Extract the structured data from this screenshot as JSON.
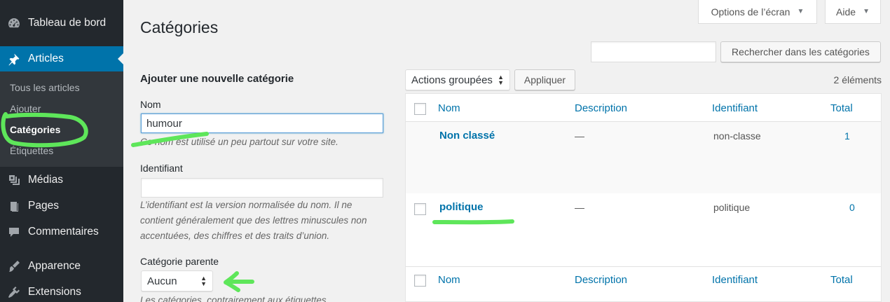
{
  "sidebar": {
    "dashboard": "Tableau de bord",
    "posts": "Articles",
    "sub": [
      "Tous les articles",
      "Ajouter",
      "Catégories",
      "Étiquettes"
    ],
    "media": "Médias",
    "pages": "Pages",
    "comments": "Commentaires",
    "appearance": "Apparence",
    "plugins": "Extensions"
  },
  "top": {
    "screen_options": "Options de l’écran",
    "help": "Aide"
  },
  "title": "Catégories",
  "search": {
    "value": "",
    "button": "Rechercher dans les catégories"
  },
  "form": {
    "heading": "Ajouter une nouvelle catégorie",
    "name_label": "Nom",
    "name_value": "humour",
    "name_help": "Ce nom est utilisé un peu partout sur votre site.",
    "slug_label": "Identifiant",
    "slug_value": "",
    "slug_help": "L’identifiant est la version normalisée du nom. Il ne contient généralement que des lettres minuscules non accentuées, des chiffres et des traits d’union.",
    "parent_label": "Catégorie parente",
    "parent_value": "Aucun",
    "parent_help": "Les catégories, contrairement aux étiquettes,"
  },
  "bulk": {
    "select": "Actions groupées",
    "apply": "Appliquer"
  },
  "items_count": "2 éléments",
  "table": {
    "columns": [
      "Nom",
      "Description",
      "Identifiant",
      "Total"
    ],
    "rows": [
      {
        "name": "Non classé",
        "description": "—",
        "slug": "non-classe",
        "count": "1"
      },
      {
        "name": "politique",
        "description": "—",
        "slug": "politique",
        "count": "0"
      }
    ]
  },
  "colors": {
    "sidebar": "#23282d",
    "accent": "#0073aa",
    "annotation": "#5ee65a"
  }
}
